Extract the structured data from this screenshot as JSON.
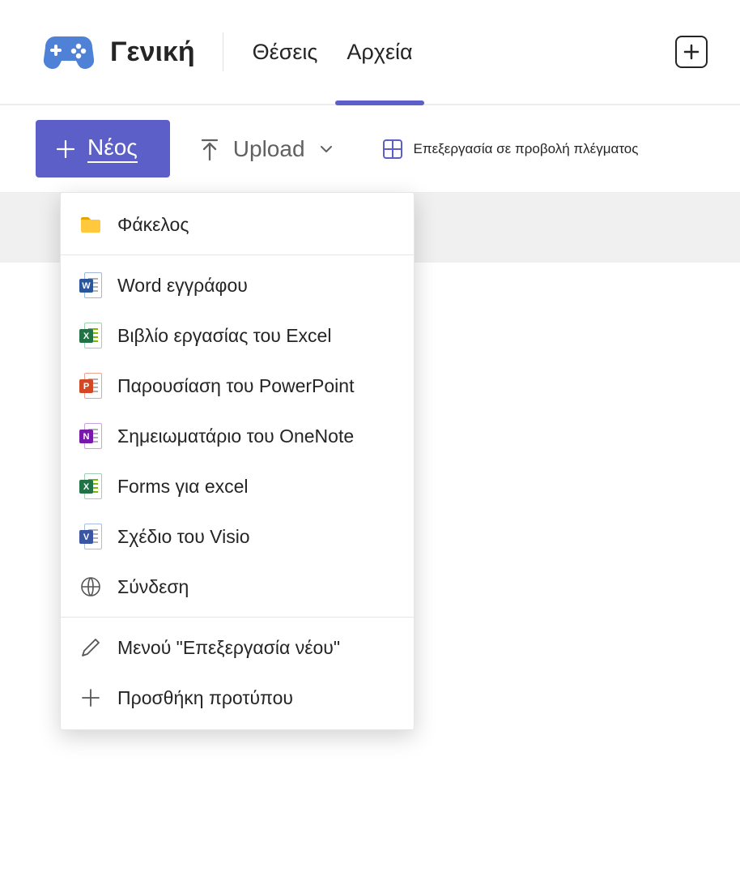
{
  "header": {
    "channel_title": "Γενική",
    "tabs": [
      {
        "label": "Θέσεις",
        "active": false
      },
      {
        "label": "Αρχεία",
        "active": true
      }
    ]
  },
  "commandbar": {
    "new_label": "Νέος",
    "upload_label": "Upload",
    "edit_grid_label": "Επεξεργασία σε προβολή πλέγματος"
  },
  "new_menu": {
    "groups": [
      {
        "items": [
          {
            "icon": "folder-icon",
            "label": "Φάκελος"
          }
        ]
      },
      {
        "items": [
          {
            "icon": "word-icon",
            "label": "Word εγγράφου"
          },
          {
            "icon": "excel-icon",
            "label": "Βιβλίο εργασίας του Excel"
          },
          {
            "icon": "powerpoint-icon",
            "label": "Παρουσίαση του PowerPoint"
          },
          {
            "icon": "onenote-icon",
            "label": "Σημειωματάριο του OneNote"
          },
          {
            "icon": "forms-excel-icon",
            "label": "Forms για excel"
          },
          {
            "icon": "visio-icon",
            "label": "Σχέδιο του Visio"
          },
          {
            "icon": "link-icon",
            "label": "Σύνδεση"
          }
        ]
      },
      {
        "items": [
          {
            "icon": "edit-icon",
            "label": "Μενού \"Επεξεργασία νέου\""
          },
          {
            "icon": "add-icon",
            "label": "Προσθήκη προτύπου"
          }
        ]
      }
    ]
  },
  "colors": {
    "accent": "#5b5fc7",
    "word": "#2b579a",
    "excel": "#217346",
    "powerpoint": "#d24726",
    "onenote": "#7719aa",
    "visio": "#3955a3",
    "folder": "#ffc83d"
  }
}
